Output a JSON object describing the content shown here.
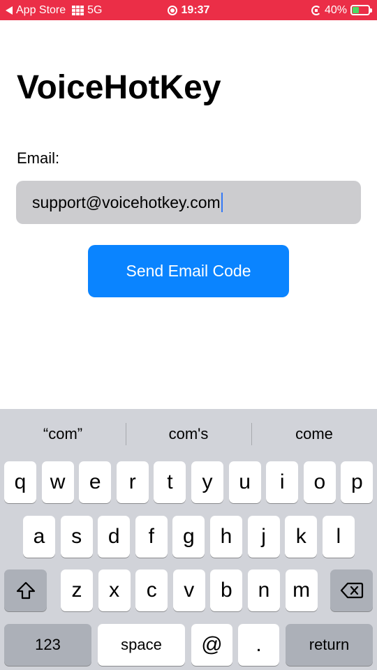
{
  "status_bar": {
    "back_label": "App Store",
    "network": "5G",
    "time": "19:37",
    "battery_percent": "40%",
    "battery_level": 0.4,
    "background_color": "#eb2e47"
  },
  "app": {
    "title": "VoiceHotKey",
    "email_label": "Email:",
    "email_value": "support@voicehotkey.com",
    "send_button_label": "Send Email Code",
    "accent_color": "#0a84ff"
  },
  "keyboard": {
    "suggestions": [
      "“com”",
      "com's",
      "come"
    ],
    "row1": [
      "q",
      "w",
      "e",
      "r",
      "t",
      "y",
      "u",
      "i",
      "o",
      "p"
    ],
    "row2": [
      "a",
      "s",
      "d",
      "f",
      "g",
      "h",
      "j",
      "k",
      "l"
    ],
    "row3": [
      "z",
      "x",
      "c",
      "v",
      "b",
      "n",
      "m"
    ],
    "bottom": {
      "numbers": "123",
      "space": "space",
      "at": "@",
      "period": ".",
      "return": "return"
    },
    "icons": {
      "shift": "shift-icon",
      "delete": "delete-icon"
    }
  }
}
